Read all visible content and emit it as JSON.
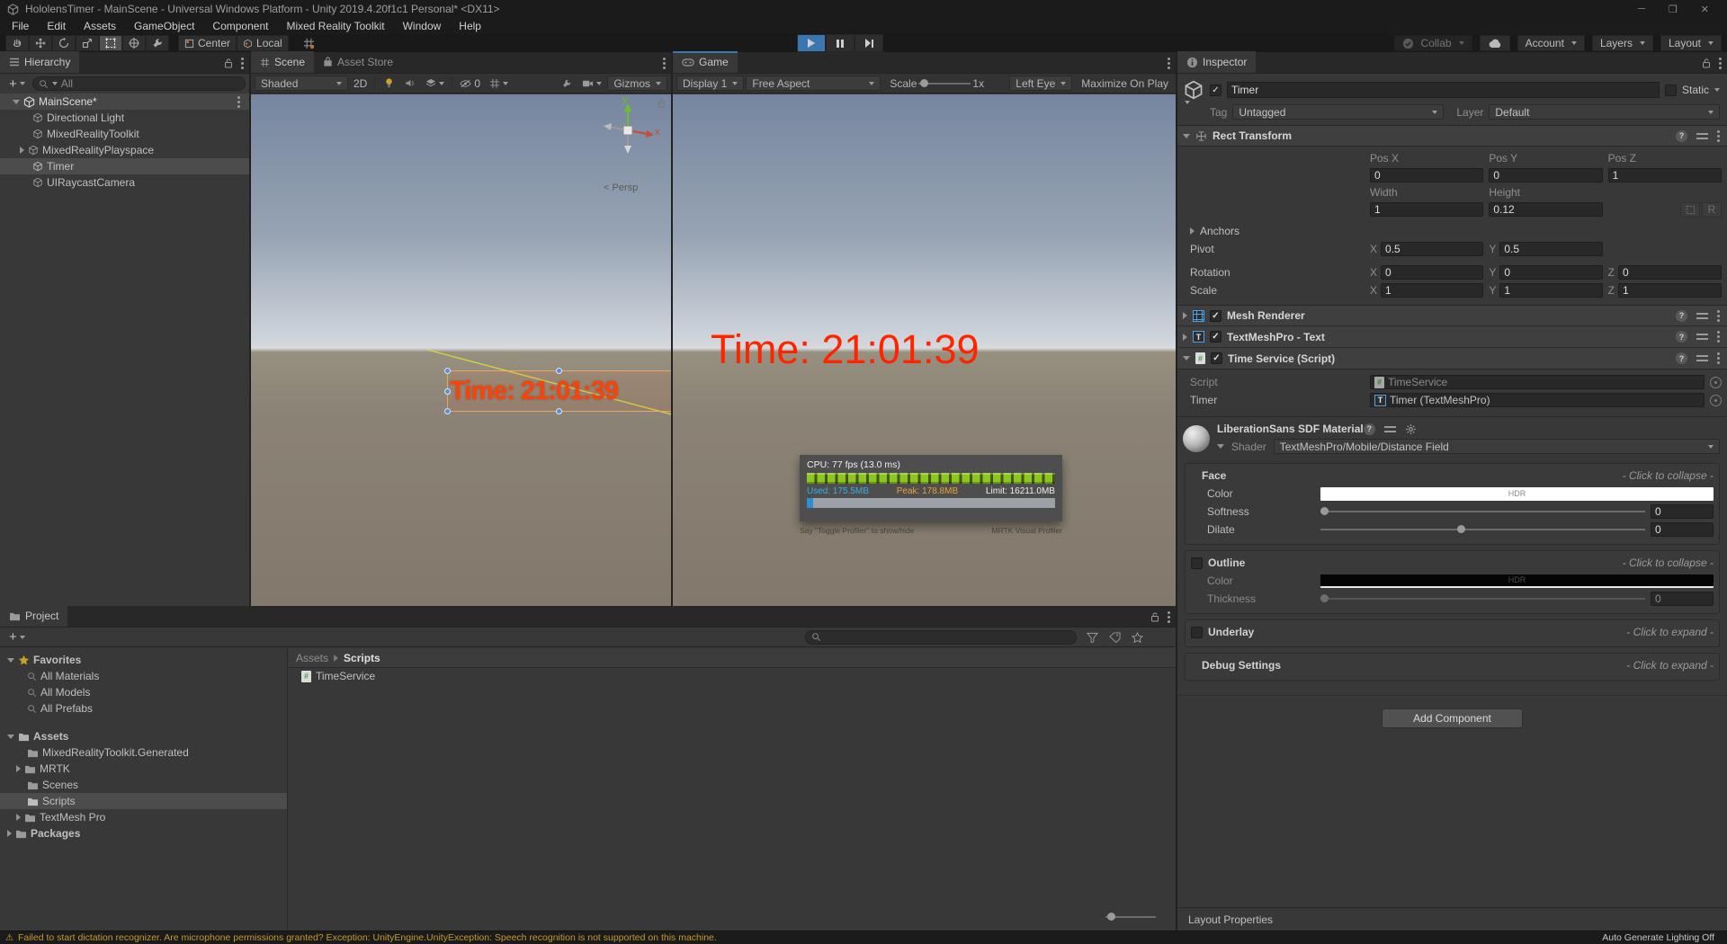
{
  "window": {
    "title": "HololensTimer - MainScene - Universal Windows Platform - Unity 2019.4.20f1c1 Personal* <DX11>"
  },
  "menu": {
    "items": [
      "File",
      "Edit",
      "Assets",
      "GameObject",
      "Component",
      "Mixed Reality Toolkit",
      "Window",
      "Help"
    ]
  },
  "toolbar": {
    "pivot_label": "Center",
    "space_label": "Local",
    "collab_label": "Collab",
    "account_label": "Account",
    "layers_label": "Layers",
    "layout_label": "Layout"
  },
  "hierarchy": {
    "tab_label": "Hierarchy",
    "search_value": "All",
    "scene_name": "MainScene*",
    "items": [
      "Directional Light",
      "MixedRealityToolkit",
      "MixedRealityPlayspace",
      "Timer",
      "UIRaycastCamera"
    ]
  },
  "scene": {
    "tab_scene": "Scene",
    "tab_asset_store": "Asset Store",
    "draw_mode": "Shaded",
    "label_2d": "2D",
    "hidden_count": "0",
    "gizmos_label": "Gizmos",
    "persp_label": "< Persp",
    "gizmo_y": "y",
    "gizmo_x": "x",
    "timer_text": "Time: 21:01:39"
  },
  "game": {
    "tab_label": "Game",
    "display": "Display 1",
    "aspect": "Free Aspect",
    "scale_label": "Scale",
    "scale_value": "1x",
    "eye": "Left Eye",
    "maximize_label": "Maximize On Play",
    "timer_text": "Time: 21:01:39",
    "profiler": {
      "cpu_line": "CPU: 77 fps (13.0 ms)",
      "used": "Used: 175.5MB",
      "peak": "Peak: 178.8MB",
      "limit": "Limit: 16211.0MB",
      "hint": "Say \"Toggle Profiler\" to show/hide",
      "title": "MRTK Visual Profiler"
    }
  },
  "project": {
    "tab_label": "Project",
    "favorites_label": "Favorites",
    "favorites": [
      "All Materials",
      "All Models",
      "All Prefabs"
    ],
    "assets_label": "Assets",
    "folders": [
      "MixedRealityToolkit.Generated",
      "MRTK",
      "Scenes",
      "Scripts",
      "TextMesh Pro"
    ],
    "packages_label": "Packages",
    "breadcrumb_root": "Assets",
    "breadcrumb_current": "Scripts",
    "file_name": "TimeService"
  },
  "inspector": {
    "tab_label": "Inspector",
    "go_name": "Timer",
    "static_label": "Static",
    "tag_label": "Tag",
    "tag_value": "Untagged",
    "layer_label": "Layer",
    "layer_value": "Default",
    "axis": {
      "x": "X",
      "y": "Y",
      "z": "Z"
    },
    "rect_transform": {
      "title": "Rect Transform",
      "pos_x_label": "Pos X",
      "pos_y_label": "Pos Y",
      "pos_z_label": "Pos Z",
      "pos_x": "0",
      "pos_y": "0",
      "pos_z": "1",
      "width_label": "Width",
      "height_label": "Height",
      "width": "1",
      "height": "0.12",
      "anchors_label": "Anchors",
      "pivot_label": "Pivot",
      "pivot_x": "0.5",
      "pivot_y": "0.5",
      "rotation_label": "Rotation",
      "rot_x": "0",
      "rot_y": "0",
      "rot_z": "0",
      "scale_label": "Scale",
      "scale_x": "1",
      "scale_y": "1",
      "scale_z": "1",
      "r_label": "R"
    },
    "components": {
      "mesh_renderer": "Mesh Renderer",
      "tmp_text": "TextMeshPro - Text",
      "time_service": "Time Service (Script)"
    },
    "script_row": {
      "label": "Script",
      "value": "TimeService"
    },
    "timer_row": {
      "label": "Timer",
      "value": "Timer (TextMeshPro)"
    },
    "material": {
      "title": "LiberationSans SDF Material",
      "shader_label": "Shader",
      "shader_value": "TextMeshPro/Mobile/Distance Field",
      "face": {
        "title": "Face",
        "hint": "- Click to collapse -",
        "color_label": "Color",
        "hdr": "HDR",
        "softness_label": "Softness",
        "softness": "0",
        "dilate_label": "Dilate",
        "dilate": "0"
      },
      "outline": {
        "title": "Outline",
        "hint": "- Click to collapse -",
        "color_label": "Color",
        "hdr": "HDR",
        "thickness_label": "Thickness",
        "thickness": "0"
      },
      "underlay": {
        "title": "Underlay",
        "hint": "- Click to expand -"
      },
      "debug": {
        "title": "Debug Settings",
        "hint": "- Click to expand -"
      }
    },
    "add_component_label": "Add Component",
    "layout_properties_label": "Layout Properties"
  },
  "status": {
    "message": "Failed to start dictation recognizer. Are microphone permissions granted? Exception: UnityEngine.UnityException: Speech recognition is not supported on this machine.",
    "right": "Auto Generate Lighting Off"
  },
  "colors": {
    "accent_blue": "#3c76b0",
    "warning_yellow": "#c69a26",
    "time_red_game": "#ff2400",
    "time_orange_scene": "#f6450c",
    "profiler_green": "#8bc71f",
    "used_cyan": "#35b1e6",
    "peak_orange": "#e8a33d"
  }
}
